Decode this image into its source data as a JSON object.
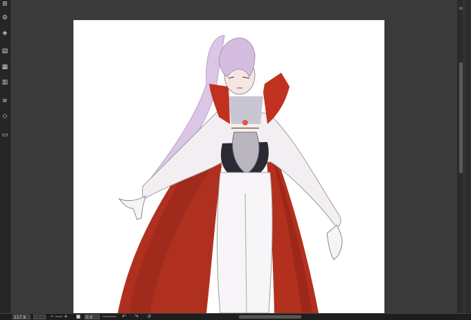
{
  "toolbar": {
    "tools": [
      {
        "icon": "layer-add-icon",
        "glyph": "⊞"
      },
      {
        "icon": "gear-layer-icon",
        "glyph": "⚙"
      },
      {
        "icon": "fill-layer-icon",
        "glyph": "◈"
      },
      {
        "icon": "layer-panel-icon",
        "glyph": "▤"
      },
      {
        "icon": "grid-icon",
        "glyph": "▦"
      },
      {
        "icon": "film-icon",
        "glyph": "▥"
      },
      {
        "icon": "stack-icon",
        "glyph": "≋"
      },
      {
        "icon": "layers-icon",
        "glyph": "◇"
      },
      {
        "icon": "folder-icon",
        "glyph": "▭"
      }
    ]
  },
  "statusbar": {
    "zoom_value": "117.9",
    "zoom_out_glyph": "−",
    "zoom_in_glyph": "+",
    "fit_glyph": "■",
    "rotation_value": "0.0",
    "rotate_left_glyph": "↶",
    "rotate_right_glyph": "↷",
    "reset_glyph": "↺"
  },
  "colors": {
    "background": "#2b2b2b",
    "canvas": "#ffffff",
    "cape_red": "#b12e22",
    "hair_lilac": "#d9c2e2"
  }
}
